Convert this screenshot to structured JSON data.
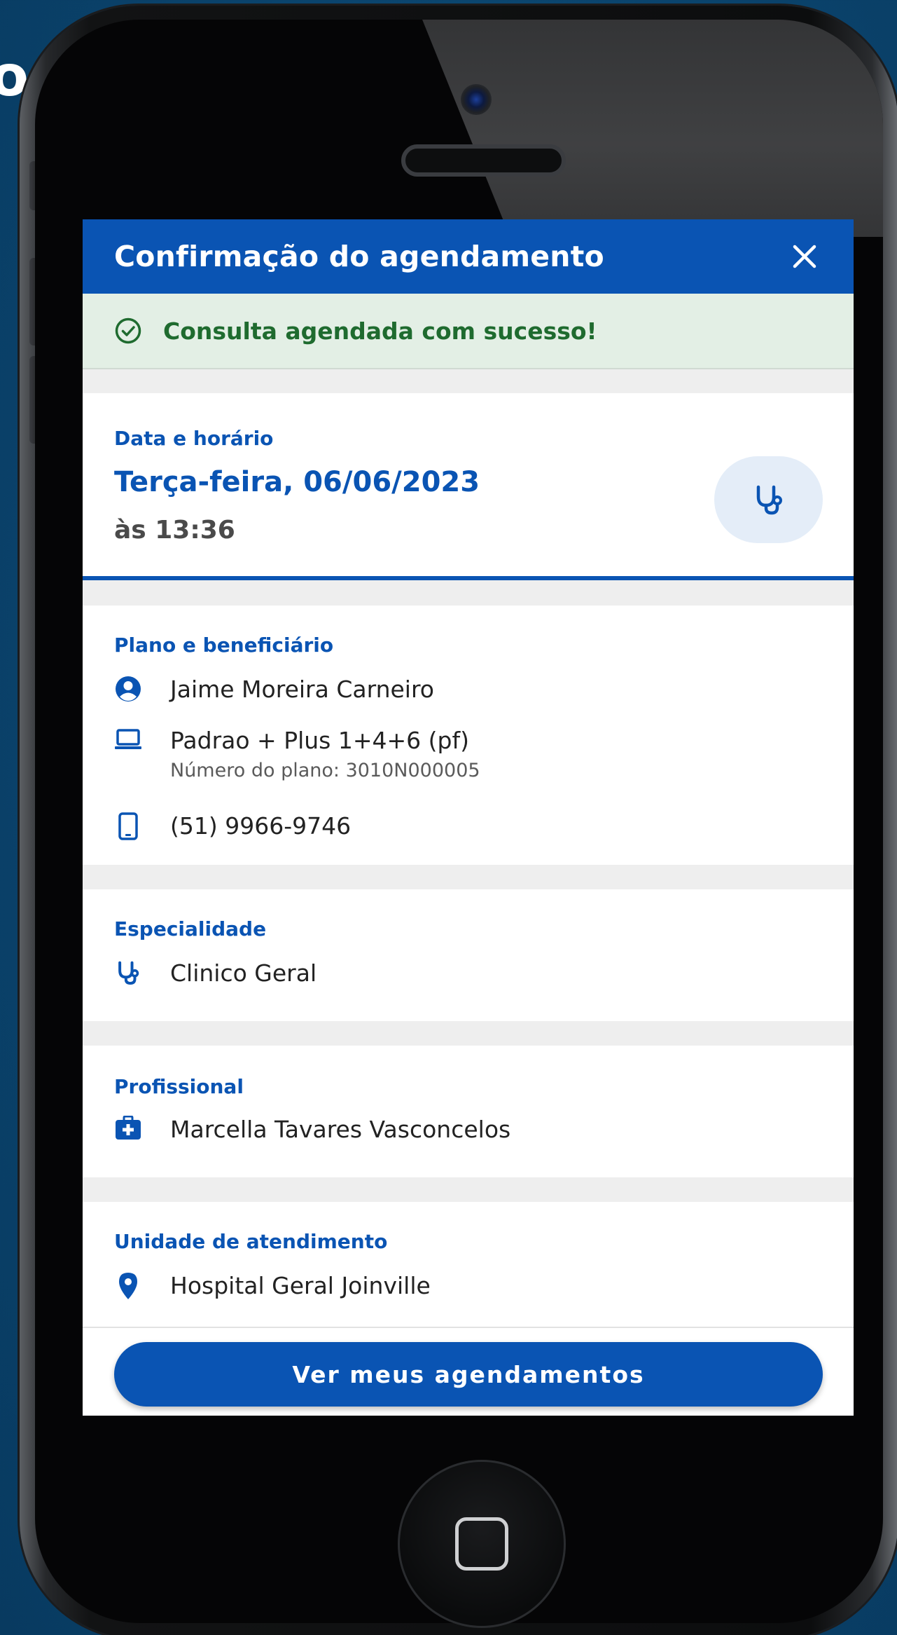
{
  "edge_text": "o",
  "header": {
    "title": "Confirmação do agendamento"
  },
  "banner": {
    "message": "Consulta agendada com sucesso!"
  },
  "datetime": {
    "label": "Data e horário",
    "date": "Terça-feira, 06/06/2023",
    "time": "às 13:36"
  },
  "plan": {
    "label": "Plano e beneficiário",
    "beneficiary": "Jaime Moreira Carneiro",
    "plan_name": "Padrao + Plus 1+4+6 (pf)",
    "plan_number": "Número do plano: 3010N000005",
    "phone": "(51) 9966-9746"
  },
  "specialty": {
    "label": "Especialidade",
    "value": "Clinico Geral"
  },
  "professional": {
    "label": "Profissional",
    "value": "Marcella Tavares Vasconcelos"
  },
  "unit": {
    "label": "Unidade de atendimento",
    "value": "Hospital Geral Joinville"
  },
  "cta": {
    "label": "Ver meus agendamentos"
  },
  "colors": {
    "primary": "#0a54b3",
    "success_bg": "#e3efe5",
    "success_text": "#1f6b2f",
    "page_bg": "#0b4670"
  },
  "icons": [
    "close-icon",
    "check-circle-icon",
    "stethoscope-icon",
    "user-circle-icon",
    "laptop-icon",
    "mobile-phone-icon",
    "medical-kit-icon",
    "location-pin-icon"
  ]
}
